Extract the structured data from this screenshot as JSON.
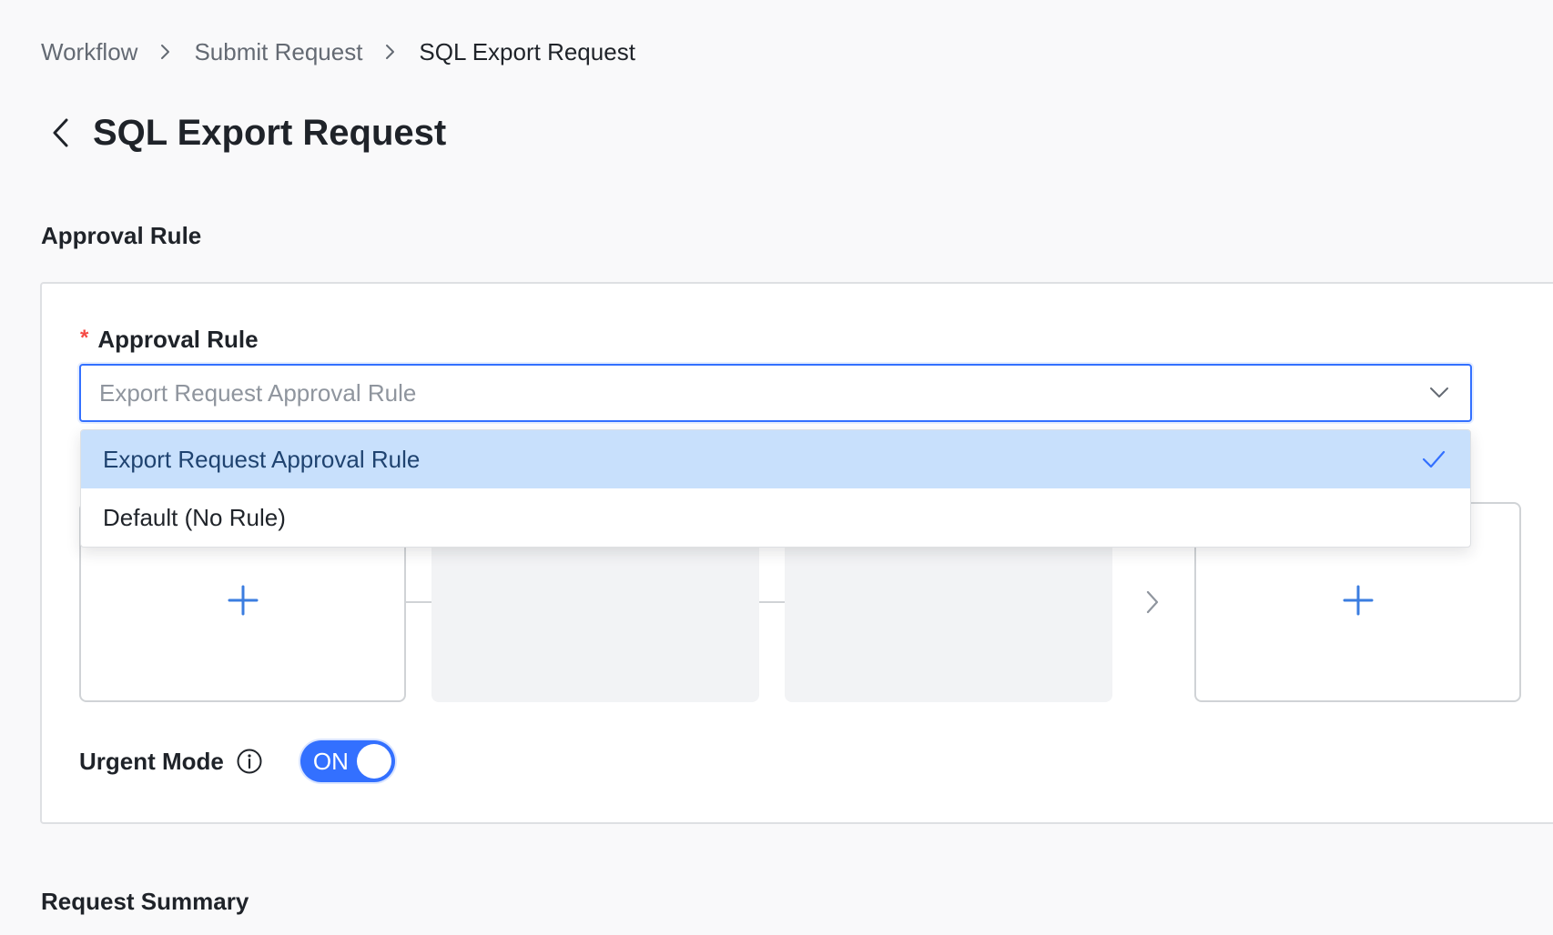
{
  "breadcrumb": {
    "items": [
      "Workflow",
      "Submit Request",
      "SQL Export Request"
    ]
  },
  "page": {
    "title": "SQL Export Request"
  },
  "approval_section": {
    "title": "Approval Rule",
    "field_label": "Approval Rule",
    "required_mark": "*",
    "select_placeholder": "Export Request Approval Rule",
    "options": [
      {
        "label": "Export Request Approval Rule",
        "selected": true
      },
      {
        "label": "Default (No Rule)",
        "selected": false
      }
    ]
  },
  "urgent_mode": {
    "label": "Urgent Mode",
    "toggle_text": "ON",
    "enabled": true
  },
  "summary_section": {
    "title": "Request Summary"
  },
  "colors": {
    "accent": "#3370ff",
    "selected_option_bg": "#c8e0fc",
    "required": "#f54a45",
    "plus_icon": "#3b7de0"
  },
  "icons": [
    "chevron-right-icon",
    "back-arrow-icon",
    "chevron-down-icon",
    "check-icon",
    "plus-icon",
    "info-icon"
  ]
}
